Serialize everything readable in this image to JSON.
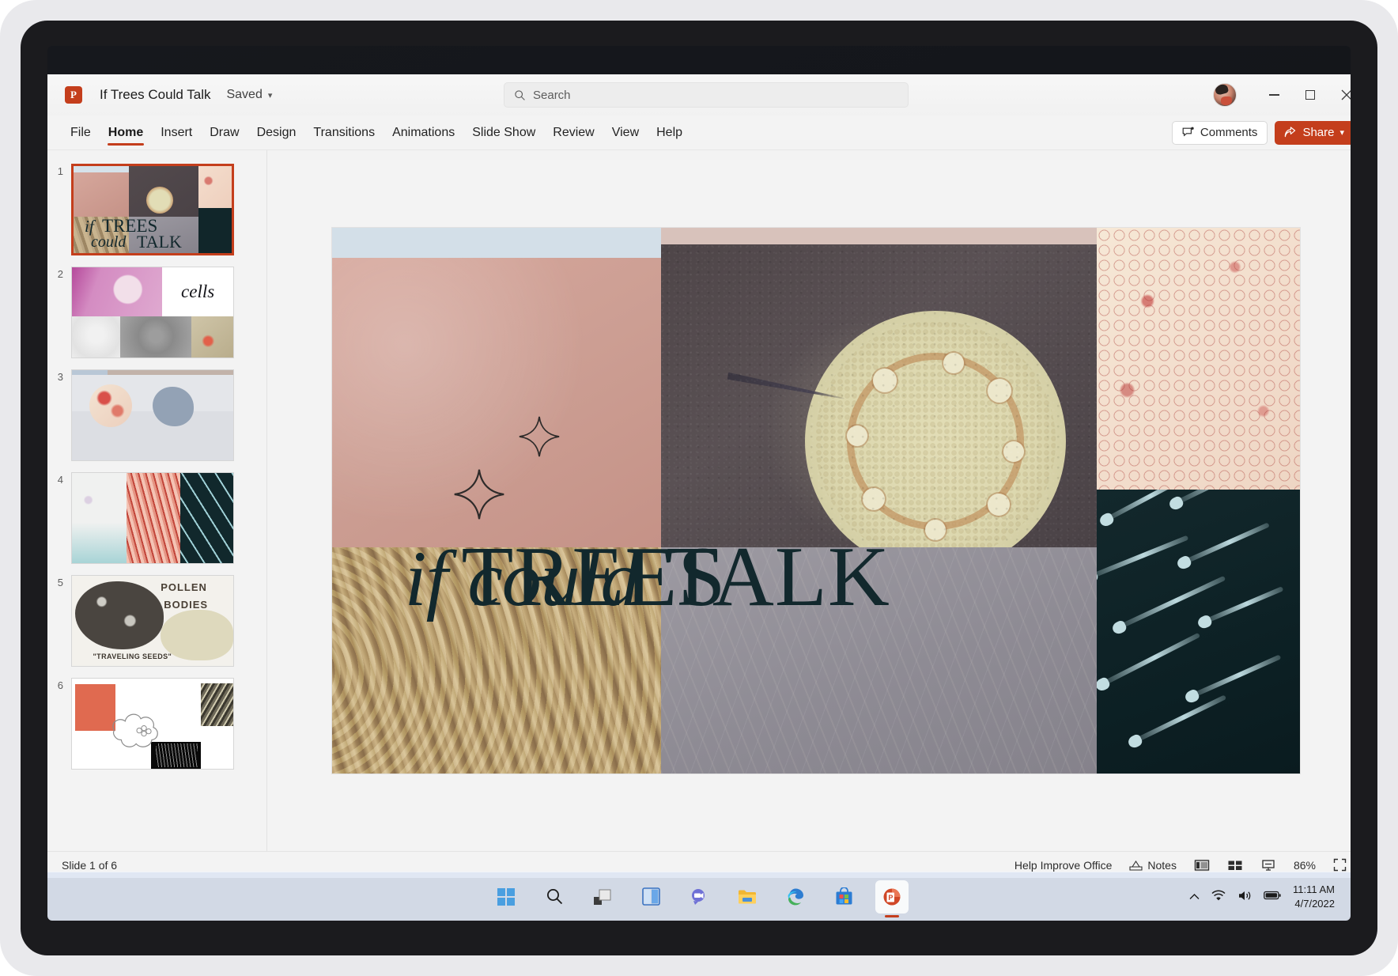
{
  "app": {
    "logo_icon": "powerpoint-logo-icon",
    "document_title": "If Trees Could Talk",
    "save_state": "Saved",
    "save_state_chevron": "⌄"
  },
  "search": {
    "icon": "search-icon",
    "placeholder": "Search",
    "value": "Search"
  },
  "window_controls": {
    "minimize_label": "–",
    "maximize_label": "□",
    "close_label": "✕",
    "avatar_name": "user-avatar"
  },
  "ribbon": {
    "tabs": [
      {
        "label": "File",
        "active": false
      },
      {
        "label": "Home",
        "active": true
      },
      {
        "label": "Insert",
        "active": false
      },
      {
        "label": "Draw",
        "active": false
      },
      {
        "label": "Design",
        "active": false
      },
      {
        "label": "Transitions",
        "active": false
      },
      {
        "label": "Animations",
        "active": false
      },
      {
        "label": "Slide Show",
        "active": false
      },
      {
        "label": "Review",
        "active": false
      },
      {
        "label": "View",
        "active": false
      },
      {
        "label": "Help",
        "active": false
      }
    ],
    "comments_label": "Comments",
    "comments_icon": "comment-icon",
    "share_label": "Share",
    "share_icon": "share-icon",
    "share_chevron": "⌄"
  },
  "thumbnails": [
    {
      "number": "1",
      "selected": true,
      "name": "slide-thumbnail-1"
    },
    {
      "number": "2",
      "selected": false,
      "name": "slide-thumbnail-2",
      "text": "cells"
    },
    {
      "number": "3",
      "selected": false,
      "name": "slide-thumbnail-3"
    },
    {
      "number": "4",
      "selected": false,
      "name": "slide-thumbnail-4"
    },
    {
      "number": "5",
      "selected": false,
      "name": "slide-thumbnail-5",
      "text_line1": "POLLEN",
      "text_line2": "BODIES",
      "text_line3": "\"TRAVELING SEEDS\""
    },
    {
      "number": "6",
      "selected": false,
      "name": "slide-thumbnail-6"
    }
  ],
  "slide": {
    "title_word_if": "if",
    "title_word_trees": "TREES",
    "title_word_could": "could",
    "title_word_talk": "TALK",
    "title_color": "#12282d"
  },
  "status_bar": {
    "slide_counter": "Slide 1 of 6",
    "help_improve": "Help Improve Office",
    "notes_label": "Notes",
    "notes_icon": "notes-icon",
    "view_normal_icon": "normal-view-icon",
    "view_sorter_icon": "slide-sorter-icon",
    "view_reading_icon": "reading-view-icon",
    "zoom_level": "86%",
    "fit_icon": "fit-to-window-icon"
  },
  "taskbar": {
    "items": [
      {
        "name": "start-button-icon",
        "label": "Start"
      },
      {
        "name": "search-taskbar-icon",
        "label": "Search"
      },
      {
        "name": "task-view-icon",
        "label": "Task View"
      },
      {
        "name": "widgets-icon",
        "label": "Widgets"
      },
      {
        "name": "chat-teams-icon",
        "label": "Chat"
      },
      {
        "name": "file-explorer-icon",
        "label": "File Explorer"
      },
      {
        "name": "edge-browser-icon",
        "label": "Microsoft Edge"
      },
      {
        "name": "microsoft-store-icon",
        "label": "Microsoft Store"
      },
      {
        "name": "powerpoint-taskbar-icon",
        "label": "PowerPoint",
        "active": true
      }
    ],
    "tray": {
      "chevron_icon": "show-hidden-icons-chevron",
      "wifi_icon": "wifi-icon",
      "volume_icon": "volume-icon",
      "battery_icon": "battery-icon",
      "time": "11:11 AM",
      "date": "4/7/2022"
    }
  },
  "colors": {
    "accent": "#c43e1c",
    "window_bg": "#f3f3f3",
    "taskbar_bg": "#dee6f2"
  }
}
